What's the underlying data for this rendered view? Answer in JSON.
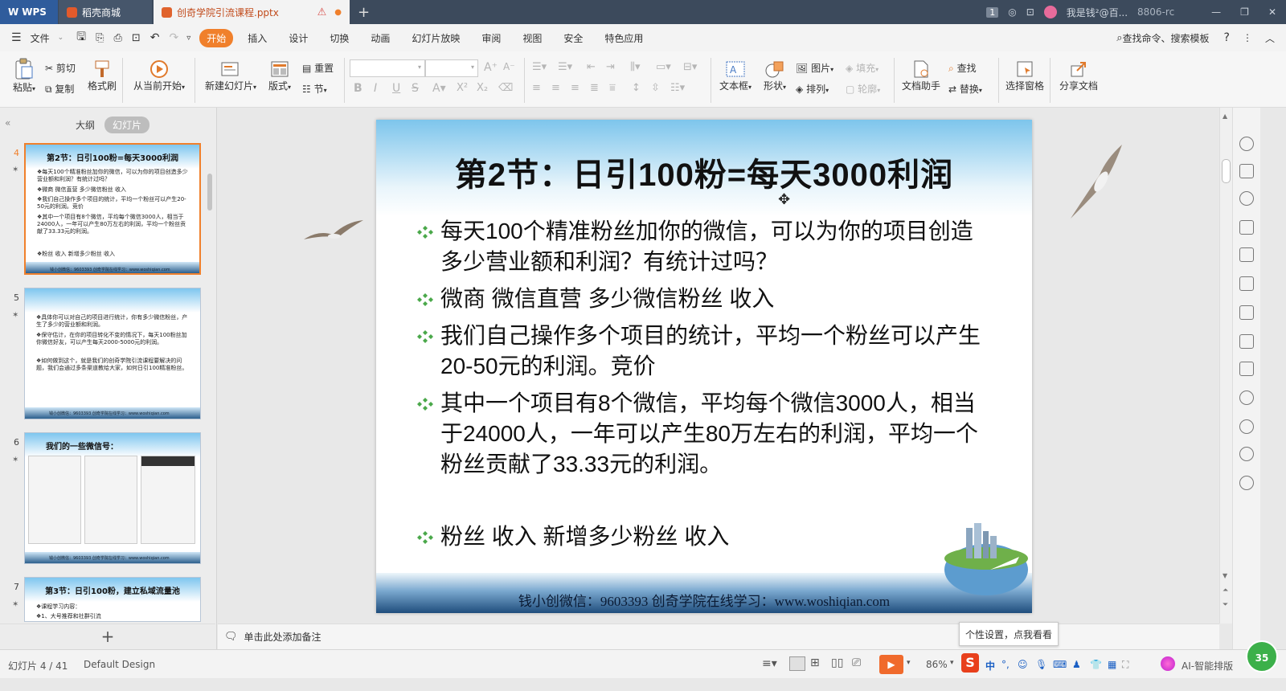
{
  "titlebar": {
    "tabs": [
      {
        "label": "WPS"
      },
      {
        "label": "稻壳商城"
      },
      {
        "label": "创奇学院引流课程.pptx"
      }
    ],
    "add_tab": "+",
    "window_count": "1",
    "user": "我是钱²@百...",
    "user_suffix": "8806-rc"
  },
  "menubar": {
    "file": "文件",
    "items": [
      "开始",
      "插入",
      "设计",
      "切换",
      "动画",
      "幻灯片放映",
      "审阅",
      "视图",
      "安全",
      "特色应用"
    ],
    "search": "查找命令、搜索模板"
  },
  "ribbon": {
    "paste": "粘贴",
    "cut": "剪切",
    "copy": "复制",
    "format_painter": "格式刷",
    "from_current": "从当前开始",
    "new_slide": "新建幻灯片",
    "layout": "版式",
    "reset": "重置",
    "section": "节",
    "textbox": "文本框",
    "shape": "形状",
    "picture": "图片",
    "fill": "填充",
    "arrange": "排列",
    "outline": "轮廓",
    "doc_assistant": "文档助手",
    "find": "查找",
    "replace": "替换",
    "select_pane": "选择窗格",
    "share_doc": "分享文档"
  },
  "left_panel": {
    "tab_outline": "大纲",
    "tab_slides": "幻灯片",
    "add": "+",
    "thumbs": [
      {
        "num": "4",
        "title": "第2节：日引100粉=每天3000利润",
        "lines": [
          "❖每天100个精准粉丝加你的微信，可以为你的项目创造多少营业额和利润？有统计过吗？",
          "❖微商 微信直营 多少微信粉丝 收入",
          "❖我们自己操作多个项目的统计，平均一个粉丝可以产生20-50元的利润。竞价",
          "❖其中一个项目有8个微信，平均每个微信3000人，相当于24000人，一年可以产生80万左右的利润，平均一个粉丝贡献了33.33元的利润。",
          "❖粉丝 收入 新增多少粉丝 收入"
        ]
      },
      {
        "num": "5",
        "title": "",
        "lines": [
          "❖具体你可以对自己的项目进行统计，你有多少微信粉丝，产生了多少的营业额和利润。",
          "❖保守估计，在你的项目转化不变的情况下，每天100粉丝加你微信好友，可以产生每天2000-5000元的利润。",
          "❖如何做到这个，就是我们的创奇学院引流课程要解决的问题，我们会通过多条渠道教给大家，如何日引100精准粉丝。"
        ]
      },
      {
        "num": "6",
        "title": "我们的一些微信号：",
        "lines": []
      },
      {
        "num": "7",
        "title": "第3节：日引100粉，建立私域流量池",
        "lines": [
          "❖课程学习内容：",
          "❖1、大号推荐和社群引流"
        ]
      }
    ],
    "footer_text": "钱小创微信：9603393  创奇学院在线学习：www.woshiqian.com"
  },
  "slide": {
    "title": "第2节：日引100粉=每天3000利润",
    "bullets": [
      "每天100个精准粉丝加你的微信，可以为你的项目创造多少营业额和利润？有统计过吗？",
      "微商 微信直营 多少微信粉丝 收入",
      "我们自己操作多个项目的统计，平均一个粉丝可以产生20-50元的利润。竞价",
      "其中一个项目有8个微信，平均每个微信3000人，相当于24000人，一年可以产生80万左右的利润，平均一个粉丝贡献了33.33元的利润。",
      "粉丝 收入 新增多少粉丝 收入"
    ],
    "footer": "钱小创微信：9603393  创奇学院在线学习：www.woshiqian.com"
  },
  "notes": {
    "placeholder": "单击此处添加备注"
  },
  "status": {
    "slide_counter": "幻灯片 4 / 41",
    "theme": "Default Design",
    "zoom": "86%",
    "ai_layout": "AI-智能排版",
    "ime_lang": "中",
    "badge": "35"
  },
  "tooltip": {
    "text": "个性设置，点我看看"
  },
  "colors": {
    "accent": "#f0802c",
    "titlebar": "#3c4a5c",
    "bullet_green": "#4aa84a"
  }
}
